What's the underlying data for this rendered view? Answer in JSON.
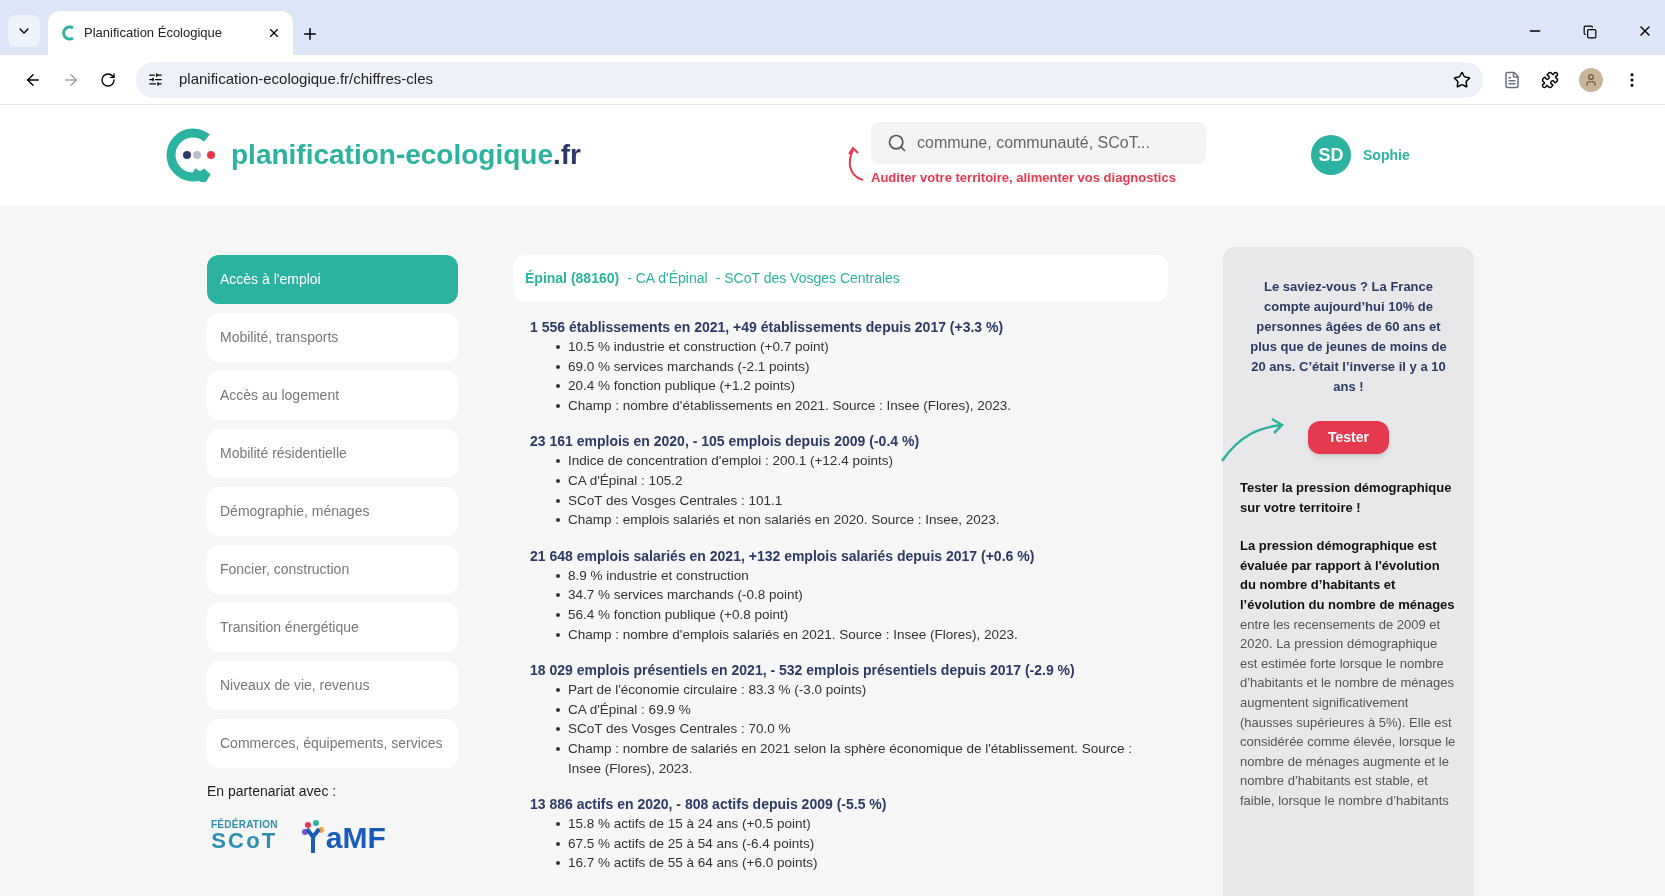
{
  "browser": {
    "tab_title": "Planification Écologique",
    "url": "planification-ecologique.fr/chiffres-cles"
  },
  "header": {
    "logo_text": "planification-ecologique",
    "logo_suffix": ".fr",
    "search": {
      "placeholder": "commune, communauté, SCoT..."
    },
    "tagline": "Auditer votre territoire, alimenter vos diagnostics",
    "user": {
      "initials": "SD",
      "name": "Sophie"
    }
  },
  "sidebar": {
    "items": [
      {
        "label": "Accès à l'emploi",
        "selected": true
      },
      {
        "label": "Mobilité, transports",
        "selected": false
      },
      {
        "label": "Accès au logement",
        "selected": false
      },
      {
        "label": "Mobilité résidentielle",
        "selected": false
      },
      {
        "label": "Démographie, ménages",
        "selected": false
      },
      {
        "label": "Foncier, construction",
        "selected": false
      },
      {
        "label": "Transition énergétique",
        "selected": false
      },
      {
        "label": "Niveaux de vie, revenus",
        "selected": false
      },
      {
        "label": "Commerces, équipements, services",
        "selected": false
      }
    ],
    "partners_label": "En partenariat avec :",
    "partners": [
      {
        "kind": "scot",
        "line1": "FÉDÉRATION",
        "line2": "SCoT"
      },
      {
        "kind": "amf",
        "line1": "aMF"
      }
    ]
  },
  "territory": {
    "commune": "Épinal (88160)",
    "parts": [
      "- CA d'Épinal",
      "- SCoT des Vosges Centrales"
    ]
  },
  "sections": [
    {
      "title": "1 556 établissements en 2021, +49 établissements depuis 2017 (+3.3 %)",
      "bullets": [
        "10.5 % industrie et construction (+0.7 point)",
        "69.0 % services marchands (-2.1 points)",
        "20.4 % fonction publique (+1.2 points)",
        "Champ : nombre d'établissements en 2021. Source : Insee (Flores), 2023."
      ]
    },
    {
      "title": "23 161 emplois en 2020, - 105 emplois depuis 2009 (-0.4 %)",
      "bullets": [
        "Indice de concentration d'emploi : 200.1 (+12.4 points)",
        "CA d'Épinal : 105.2",
        "SCoT des Vosges Centrales : 101.1",
        "Champ : emplois salariés et non salariés en 2020. Source : Insee, 2023."
      ]
    },
    {
      "title": "21 648 emplois salariés en 2021, +132 emplois salariés depuis 2017 (+0.6 %)",
      "bullets": [
        "8.9 % industrie et construction",
        "34.7 % services marchands (-0.8 point)",
        "56.4 % fonction publique (+0.8 point)",
        "Champ : nombre d'emplois salariés en 2021. Source : Insee (Flores), 2023."
      ]
    },
    {
      "title": "18 029 emplois présentiels en 2021, - 532 emplois présentiels depuis 2017 (-2.9 %)",
      "bullets": [
        "Part de l'économie circulaire : 83.3 % (-3.0 points)",
        "CA d'Épinal : 69.9 %",
        "SCoT des Vosges Centrales : 70.0 %",
        "Champ : nombre de salariés en 2021 selon la sphère économique de l'établissement. Source : Insee (Flores), 2023."
      ]
    },
    {
      "title": "13 886 actifs en 2020, - 808 actifs depuis 2009 (-5.5 %)",
      "bullets": [
        "15.8 % actifs de 15 à 24 ans (+0.5 point)",
        "67.5 % actifs de 25 à 54 ans (-6.4 points)",
        "16.7 % actifs de 55 à 64 ans (+6.0 points)"
      ]
    }
  ],
  "aside": {
    "fact": "Le saviez-vous ? La France compte aujourd’hui 10% de personnes âgées de 60 ans et plus que de jeunes de moins de 20 ans. C’était l’inverse il y a 10 ans !",
    "button": "Tester",
    "heading": "Tester la pression démographique sur votre territoire !",
    "body": "**La pression démographique est évaluée par rapport à l'évolution du nombre d’habitants et l’évolution du nombre de ménages** entre les recensements de 2009 et 2020. La pression démographique est estimée forte lorsque le nombre d’habitants et le nombre de ménages augmentent significativement (hausses supérieures à 5%). Elle est considérée comme élevée, lorsque le nombre de ménages augmente et le nombre d’habitants est stable, et faible, lorsque le nombre d’habitants"
  }
}
